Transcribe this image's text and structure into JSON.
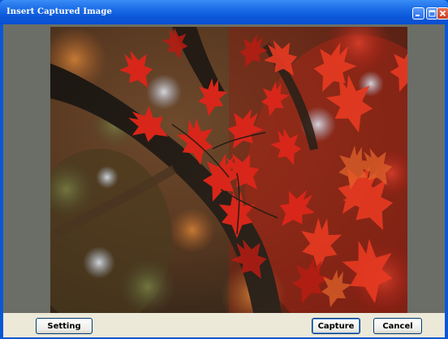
{
  "window": {
    "title": "Insert Captured Image",
    "accent_color": "#0a57d6"
  },
  "titlebar_controls": {
    "minimize_icon": "minimize-icon",
    "maximize_icon": "maximize-icon",
    "close_icon": "close-icon"
  },
  "preview": {
    "subject": "red maple leaves on a dark branch"
  },
  "buttons": {
    "setting_label": "Setting",
    "capture_label": "Capture",
    "cancel_label": "Cancel"
  }
}
